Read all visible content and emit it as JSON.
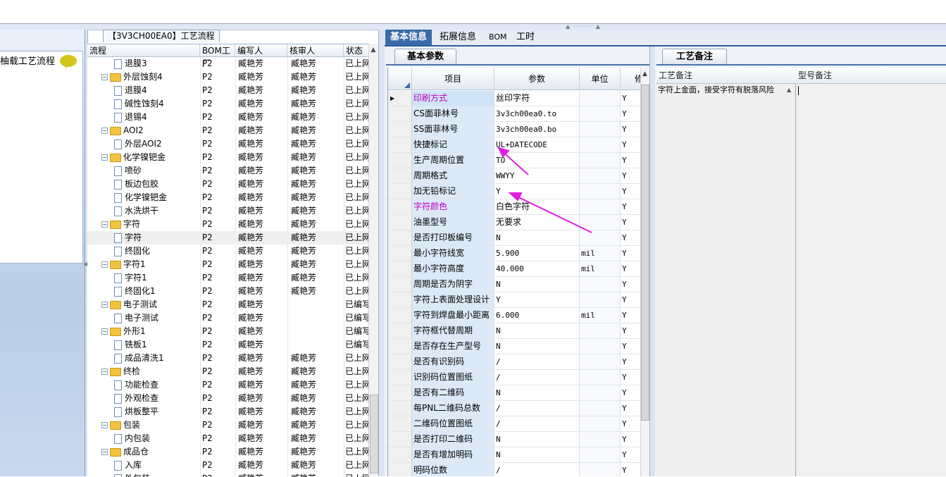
{
  "left_panel": {
    "title": "柚载工艺流程",
    "icon": "speech-bubble-icon"
  },
  "tree": {
    "tab_label": "【3V3CH00EA0】工艺流程",
    "headers": [
      "流程",
      "BOM工厂",
      "编写人",
      "核审人",
      "状态"
    ],
    "rows": [
      {
        "name": "退膜3",
        "level": 2,
        "folder": false,
        "bom": "P2",
        "writer": "臧艳芳",
        "reviewer": "臧艳芳",
        "status": "已上网"
      },
      {
        "name": "外层蚀刻4",
        "level": 1,
        "folder": true,
        "bom": "P2",
        "writer": "臧艳芳",
        "reviewer": "臧艳芳",
        "status": "已上网"
      },
      {
        "name": "退膜4",
        "level": 2,
        "folder": false,
        "bom": "P2",
        "writer": "臧艳芳",
        "reviewer": "臧艳芳",
        "status": "已上网"
      },
      {
        "name": "碱性蚀刻4",
        "level": 2,
        "folder": false,
        "bom": "P2",
        "writer": "臧艳芳",
        "reviewer": "臧艳芳",
        "status": "已上网"
      },
      {
        "name": "退锡4",
        "level": 2,
        "folder": false,
        "bom": "P2",
        "writer": "臧艳芳",
        "reviewer": "臧艳芳",
        "status": "已上网"
      },
      {
        "name": "AOI2",
        "level": 1,
        "folder": true,
        "bom": "P2",
        "writer": "臧艳芳",
        "reviewer": "臧艳芳",
        "status": "已上网"
      },
      {
        "name": "外层AOI2",
        "level": 2,
        "folder": false,
        "bom": "P2",
        "writer": "臧艳芳",
        "reviewer": "臧艳芳",
        "status": "已上网"
      },
      {
        "name": "化学镍钯金",
        "level": 1,
        "folder": true,
        "bom": "P2",
        "writer": "臧艳芳",
        "reviewer": "臧艳芳",
        "status": "已上网"
      },
      {
        "name": "喷砂",
        "level": 2,
        "folder": false,
        "bom": "P2",
        "writer": "臧艳芳",
        "reviewer": "臧艳芳",
        "status": "已上网"
      },
      {
        "name": "板边包胶",
        "level": 2,
        "folder": false,
        "bom": "P2",
        "writer": "臧艳芳",
        "reviewer": "臧艳芳",
        "status": "已上网"
      },
      {
        "name": "化学镍钯金",
        "level": 2,
        "folder": false,
        "bom": "P2",
        "writer": "臧艳芳",
        "reviewer": "臧艳芳",
        "status": "已上网"
      },
      {
        "name": "水洗烘干",
        "level": 2,
        "folder": false,
        "bom": "P2",
        "writer": "臧艳芳",
        "reviewer": "臧艳芳",
        "status": "已上网"
      },
      {
        "name": "字符",
        "level": 1,
        "folder": true,
        "bom": "P2",
        "writer": "臧艳芳",
        "reviewer": "臧艳芳",
        "status": "已上网"
      },
      {
        "name": "字符",
        "level": 2,
        "folder": false,
        "bom": "P2",
        "writer": "臧艳芳",
        "reviewer": "臧艳芳",
        "status": "已上网",
        "selected": true
      },
      {
        "name": "终固化",
        "level": 2,
        "folder": false,
        "bom": "P2",
        "writer": "臧艳芳",
        "reviewer": "臧艳芳",
        "status": "已上网"
      },
      {
        "name": "字符1",
        "level": 1,
        "folder": true,
        "bom": "P2",
        "writer": "臧艳芳",
        "reviewer": "臧艳芳",
        "status": "已上网"
      },
      {
        "name": "字符1",
        "level": 2,
        "folder": false,
        "bom": "P2",
        "writer": "臧艳芳",
        "reviewer": "臧艳芳",
        "status": "已上网"
      },
      {
        "name": "终固化1",
        "level": 2,
        "folder": false,
        "bom": "P2",
        "writer": "臧艳芳",
        "reviewer": "臧艳芳",
        "status": "已上网"
      },
      {
        "name": "电子测试",
        "level": 1,
        "folder": true,
        "bom": "P2",
        "writer": "臧艳芳",
        "reviewer": "",
        "status": "已编写"
      },
      {
        "name": "电子测试",
        "level": 2,
        "folder": false,
        "bom": "P2",
        "writer": "臧艳芳",
        "reviewer": "",
        "status": "已编写"
      },
      {
        "name": "外形1",
        "level": 1,
        "folder": true,
        "bom": "P2",
        "writer": "臧艳芳",
        "reviewer": "",
        "status": "已编写"
      },
      {
        "name": "铣板1",
        "level": 2,
        "folder": false,
        "bom": "P2",
        "writer": "臧艳芳",
        "reviewer": "",
        "status": "已编写"
      },
      {
        "name": "成品清洗1",
        "level": 2,
        "folder": false,
        "bom": "P2",
        "writer": "臧艳芳",
        "reviewer": "臧艳芳",
        "status": "已上网"
      },
      {
        "name": "终检",
        "level": 1,
        "folder": true,
        "bom": "P2",
        "writer": "臧艳芳",
        "reviewer": "臧艳芳",
        "status": "已上网"
      },
      {
        "name": "功能检查",
        "level": 2,
        "folder": false,
        "bom": "P2",
        "writer": "臧艳芳",
        "reviewer": "臧艳芳",
        "status": "已上网"
      },
      {
        "name": "外观检查",
        "level": 2,
        "folder": false,
        "bom": "P2",
        "writer": "臧艳芳",
        "reviewer": "臧艳芳",
        "status": "已上网"
      },
      {
        "name": "烘板整平",
        "level": 2,
        "folder": false,
        "bom": "P2",
        "writer": "臧艳芳",
        "reviewer": "臧艳芳",
        "status": "已上网"
      },
      {
        "name": "包装",
        "level": 1,
        "folder": true,
        "bom": "P2",
        "writer": "臧艳芳",
        "reviewer": "臧艳芳",
        "status": "已上网"
      },
      {
        "name": "内包装",
        "level": 2,
        "folder": false,
        "bom": "P2",
        "writer": "臧艳芳",
        "reviewer": "臧艳芳",
        "status": "已上网"
      },
      {
        "name": "成品仓",
        "level": 1,
        "folder": true,
        "bom": "P2",
        "writer": "臧艳芳",
        "reviewer": "臧艳芳",
        "status": "已上网"
      },
      {
        "name": "入库",
        "level": 2,
        "folder": false,
        "bom": "P2",
        "writer": "臧艳芳",
        "reviewer": "臧艳芳",
        "status": "已上网"
      },
      {
        "name": "外包装",
        "level": 2,
        "folder": false,
        "bom": "P2",
        "writer": "臧艳芳",
        "reviewer": "臧艳芳",
        "status": "已上网"
      }
    ]
  },
  "main_tabs": [
    "基本信息",
    "拓展信息",
    "BOM",
    "工时"
  ],
  "basic_params": {
    "tab_label": "基本参数",
    "headers": [
      "项目",
      "参数",
      "单位",
      "修"
    ],
    "rows": [
      {
        "item": "印刷方式",
        "value": "丝印字符",
        "unit": "",
        "flag": "Y",
        "magenta": true
      },
      {
        "item": "CS面菲林号",
        "value": "3v3ch00ea0.to",
        "unit": "",
        "flag": "Y"
      },
      {
        "item": "SS面菲林号",
        "value": "3v3ch00ea0.bo",
        "unit": "",
        "flag": "Y"
      },
      {
        "item": "快捷标记",
        "value": "UL+DATECODE",
        "unit": "",
        "flag": "Y"
      },
      {
        "item": "生产周期位置",
        "value": "TO",
        "unit": "",
        "flag": "Y"
      },
      {
        "item": "周期格式",
        "value": "WWYY",
        "unit": "",
        "flag": "Y"
      },
      {
        "item": "加无铅标记",
        "value": "Y",
        "unit": "",
        "flag": "Y"
      },
      {
        "item": "字符颜色",
        "value": "白色字符",
        "unit": "",
        "flag": "Y",
        "magenta": true
      },
      {
        "item": "油墨型号",
        "value": "无要求",
        "unit": "",
        "flag": "Y"
      },
      {
        "item": "是否打印板编号",
        "value": "N",
        "unit": "",
        "flag": "Y"
      },
      {
        "item": "最小字符线宽",
        "value": "5.900",
        "unit": "mil",
        "flag": "Y"
      },
      {
        "item": "最小字符高度",
        "value": "40.000",
        "unit": "mil",
        "flag": "Y"
      },
      {
        "item": "周期是否为阴字",
        "value": "N",
        "unit": "",
        "flag": "Y"
      },
      {
        "item": "字符上表面处理设计",
        "value": "Y",
        "unit": "",
        "flag": "Y"
      },
      {
        "item": "字符到焊盘最小距离",
        "value": "6.000",
        "unit": "mil",
        "flag": "Y"
      },
      {
        "item": "字符框代替周期",
        "value": "N",
        "unit": "",
        "flag": "Y"
      },
      {
        "item": "是否存在生产型号",
        "value": "N",
        "unit": "",
        "flag": "Y"
      },
      {
        "item": "是否有识别码",
        "value": "/",
        "unit": "",
        "flag": "Y"
      },
      {
        "item": "识别码位置图纸",
        "value": "/",
        "unit": "",
        "flag": "Y"
      },
      {
        "item": "是否有二维码",
        "value": "N",
        "unit": "",
        "flag": "Y"
      },
      {
        "item": "每PNL二维码总数",
        "value": "/",
        "unit": "",
        "flag": "Y"
      },
      {
        "item": "二维码位置图纸",
        "value": "/",
        "unit": "",
        "flag": "Y"
      },
      {
        "item": "是否打印二维码",
        "value": "N",
        "unit": "",
        "flag": "Y"
      },
      {
        "item": "是否有增加明码",
        "value": "N",
        "unit": "",
        "flag": "Y"
      },
      {
        "item": "明码位数",
        "value": "/",
        "unit": "",
        "flag": "Y"
      }
    ]
  },
  "remarks": {
    "tab_label": "工艺备注",
    "headers": [
      "工艺备注",
      "型号备注"
    ],
    "process_note": "字符上金面，接受字符有脱落风险",
    "model_note": ""
  },
  "colors": {
    "accent": "#3a6aa8",
    "magenta_label": "#c000c0",
    "arrow": "#e020e0"
  }
}
